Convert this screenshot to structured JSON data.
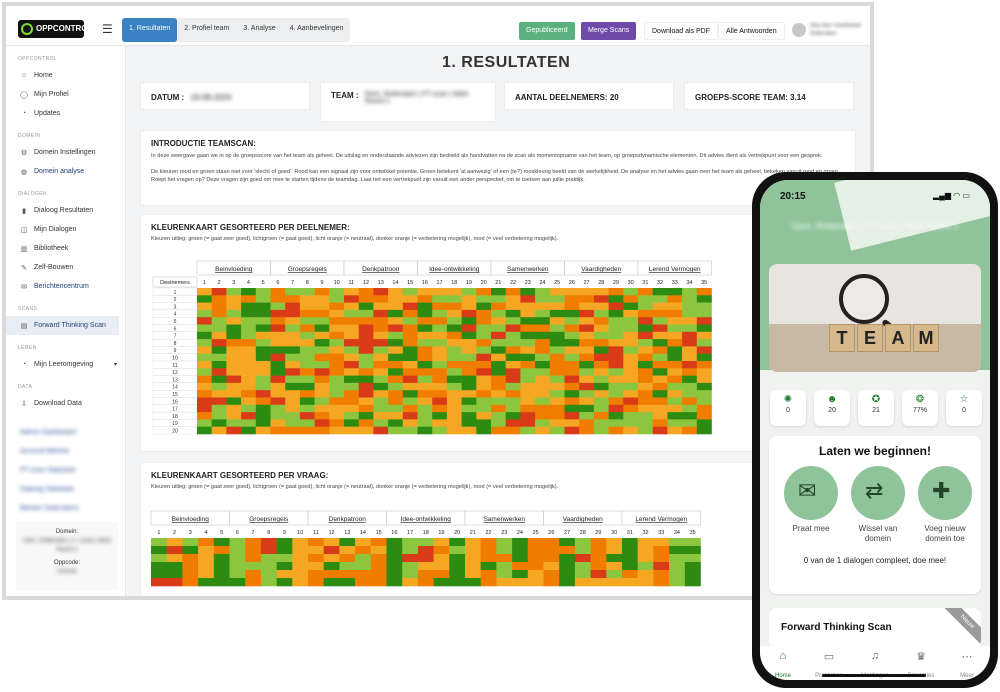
{
  "app": {
    "brand": "OPPCONTROL",
    "user_name": "Wie ben Voorbeeld Gebruiker"
  },
  "topbar": {
    "steps": [
      "1. Resultaten",
      "2. Profiel team",
      "3. Analyse",
      "4. Aanbevelingen"
    ],
    "published": "Gepubliceerd",
    "merge": "Merge Scans",
    "download_pdf": "Download als PDF",
    "all_answers": "Alle Antwoorden"
  },
  "sidebar": {
    "sections": [
      {
        "title": "OPPCONTROL",
        "items": [
          {
            "label": "Home",
            "icon": "⌂"
          },
          {
            "label": "Mijn Profiel",
            "icon": "◯"
          },
          {
            "label": "Updates",
            "icon": "◔"
          }
        ]
      },
      {
        "title": "DOMEIN",
        "items": [
          {
            "label": "Domein Instellingen",
            "icon": "⚙"
          },
          {
            "label": "Domein analyse",
            "icon": "◍",
            "blue": true
          }
        ]
      },
      {
        "title": "DIALOGEN",
        "items": [
          {
            "label": "Dialoog Resultaten",
            "icon": "▮"
          },
          {
            "label": "Mijn Dialogen",
            "icon": "◫"
          },
          {
            "label": "Bibliotheek",
            "icon": "▥"
          },
          {
            "label": "Zelf-Bouwen",
            "icon": "✎"
          },
          {
            "label": "Berichtencentrum",
            "icon": "✉",
            "blue": true
          }
        ]
      },
      {
        "title": "SCANS",
        "items": [
          {
            "label": "Forward Thinking Scan",
            "icon": "▤",
            "active": true
          }
        ]
      },
      {
        "title": "LEREN",
        "items": [
          {
            "label": "Mijn Leeromgeving",
            "icon": "◔",
            "chevron": true
          }
        ]
      },
      {
        "title": "DATA",
        "items": [
          {
            "label": "Download Data",
            "icon": "⇩"
          }
        ]
      }
    ],
    "blurred_items": [
      "Admin Dashboard",
      "Account Beheer",
      "FT-scan Statistiek",
      "Dialoog Statistiek",
      "Beheer Gebruikers"
    ],
    "footer": {
      "domain_label": "Domein:",
      "domain_value": "Gem. Rotterdam | FT-scan | M&A Noord 1",
      "code_label": "Oppcode:",
      "code_value": "000000"
    }
  },
  "main": {
    "title": "1. RESULTATEN",
    "info": {
      "datum_label": "DATUM :",
      "datum_value": "19-08-2024",
      "team_label": "TEAM :",
      "team_value": "Gem. Rotterdam | FT-scan | M&A Noord 1",
      "deelnemers": "AANTAL DEELNEMERS: 20",
      "score": "GROEPS-SCORE TEAM: 3.14"
    },
    "intro": {
      "title": "INTRODUCTIE TEAMSCAN:",
      "p1": "In deze weergave gaan we in op de groepsscore van het team als geheel. De uitslag en onderstaande adviezen zijn bedoeld als handvatten na de scan als momentopname van het team, op groepsdynamische elementen. Dit advies dient als vertrekpunt voor een gesprek.",
      "p2": "De kleuren rood en groen staan niet voor 'slecht of goed'. Rood kan een signaal zijn voor ontwikkel potentie. Groen betekent 'al aanwezig' of een (te?) rooskleurig beeld van de werkelijkheid. De analyse en het advies gaan over het team als geheel, bekeken vanuit rood en groen. Roept het vragen op? Deze vragen zijn goed om mee te starten tijdens de teamdag. Laat het een vertrekpunt zijn vanuit een ander perspectief, om te toetsen aan jullie praktijk."
    },
    "heatmap1": {
      "title": "KLEURENKAART GESORTEERD PER DEELNEMER:",
      "legend": "Kleuren uitleg: groen (= gaat zeer goed), lichtgroen (= gaat goed), licht oranje (= neutraal), donker oranje (= verbetering mogelijk), rood (= veel verbetering mogelijk).",
      "row_header": "Deelnemers",
      "categories": [
        "Beinvloeding",
        "Groepsregels",
        "Denkpatroon",
        "Idee-ontwikkeling",
        "Samenwerken",
        "Vaardigheden",
        "Lerend Vermogen"
      ]
    },
    "heatmap2": {
      "title": "KLEURENKAART GESORTEERD PER VRAAG:",
      "legend": "Kleuren uitleg: groen (= gaat zeer goed), lichtgroen (= gaat goed), licht oranje (= neutraal), donker oranje (= verbetering mogelijk), rood (= veel verbetering mogelijk).",
      "categories": [
        "Beinvloeding",
        "Groepsregels",
        "Denkpatroon",
        "Idee-ontwikkeling",
        "Samenwerken",
        "Vaardigheden",
        "Lerend Vermogen"
      ]
    },
    "score_colors": [
      "#2e8b12",
      "#8cc63f",
      "#f5a623",
      "#f07d00",
      "#d93b18"
    ]
  },
  "phone": {
    "time": "20:15",
    "team_title": "Gem. Rotterdam | FT-scan | M&A Noord 1",
    "image_word": "TEAM",
    "stats": [
      {
        "icon": "bulb-group-icon",
        "glyph": "✺",
        "value": "0"
      },
      {
        "icon": "people-icon",
        "glyph": "☻",
        "value": "20"
      },
      {
        "icon": "idea-icon",
        "glyph": "✪",
        "value": "21"
      },
      {
        "icon": "brain-icon",
        "glyph": "❂",
        "value": "77%"
      },
      {
        "icon": "star-icon",
        "glyph": "☆",
        "value": "0"
      }
    ],
    "begin_title": "Laten we beginnen!",
    "options": [
      {
        "label": "Praat mee",
        "glyph": "✉"
      },
      {
        "label": "Wissel van domein",
        "glyph": "⇄"
      },
      {
        "label": "Voeg nieuw domein toe",
        "glyph": "✚"
      }
    ],
    "progress": "0 van de 1 dialogen compleet, doe mee!",
    "ft_title": "Forward Thinking Scan",
    "ribbon": "Nieuw",
    "nav": [
      {
        "label": "Home",
        "glyph": "⌂",
        "active": true
      },
      {
        "label": "Praat mee",
        "glyph": "▭"
      },
      {
        "label": "Meldingen",
        "glyph": "♫"
      },
      {
        "label": "Prestaties",
        "glyph": "♛"
      },
      {
        "label": "Meer",
        "glyph": "⋯"
      }
    ]
  }
}
